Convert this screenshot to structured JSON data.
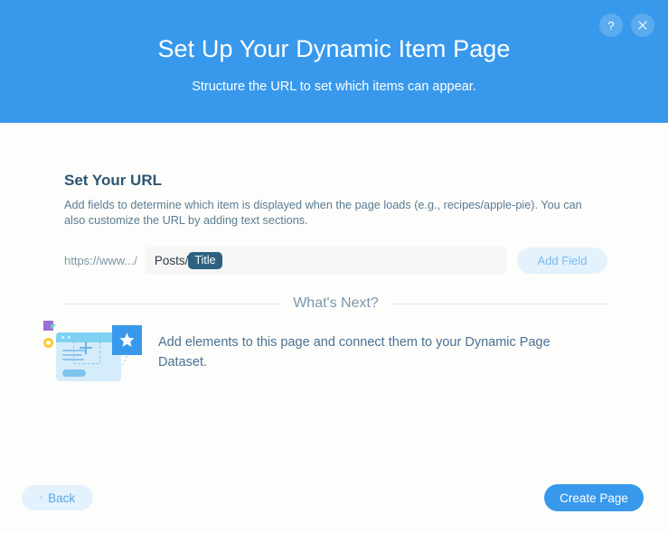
{
  "header": {
    "title": "Set Up Your Dynamic Item Page",
    "subtitle": "Structure the URL to set which items can appear.",
    "help_label": "?",
    "close_label": "×",
    "background_color": "#3899ec"
  },
  "url_section": {
    "title": "Set Your URL",
    "description": "Add fields to determine which item is displayed when the page loads (e.g., recipes/apple-pie). You can also customize the URL by adding text sections.",
    "prefix": "https://www.../",
    "static_segment": "Posts/",
    "field_chip": "Title",
    "add_field_label": "Add Field",
    "chip_color": "#2d6180"
  },
  "whats_next": {
    "label": "What's Next?",
    "description": "Add elements to this page and connect them to your Dynamic Page Dataset.",
    "illustration_name": "dynamic-page-elements-illustration"
  },
  "footer": {
    "back_label": "Back",
    "back_chevron": "‹",
    "create_label": "Create Page",
    "create_color": "#3899ec"
  }
}
